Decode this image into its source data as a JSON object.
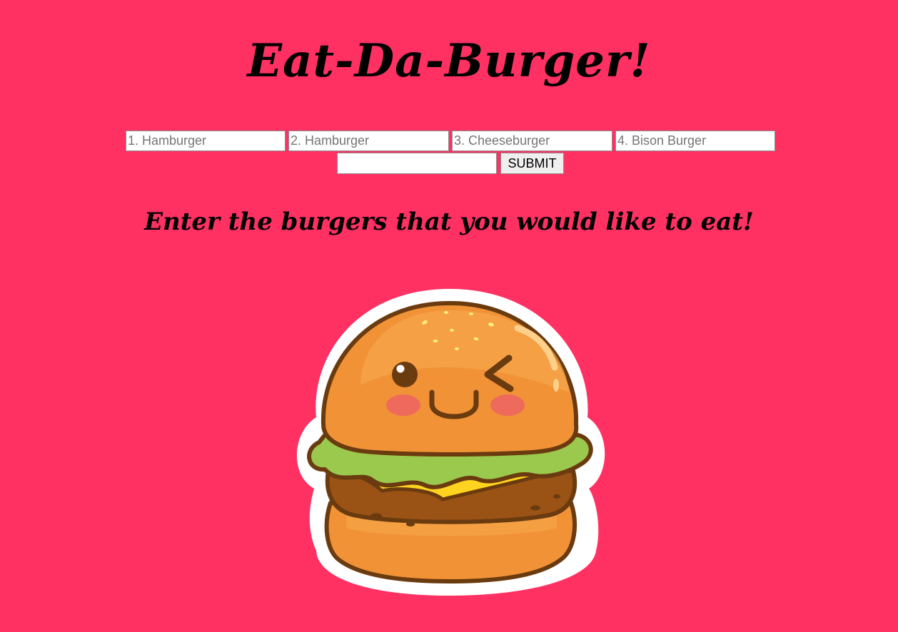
{
  "page": {
    "title": "Eat-Da-Burger!",
    "subtitle": "Enter the burgers that you would like to eat!",
    "background_color": "#ff3163"
  },
  "form": {
    "inputs": [
      {
        "placeholder": "1. Hamburger",
        "value": ""
      },
      {
        "placeholder": "2. Hamburger",
        "value": ""
      },
      {
        "placeholder": "3. Cheeseburger",
        "value": ""
      },
      {
        "placeholder": "4. Bison Burger",
        "value": ""
      },
      {
        "placeholder": "",
        "value": ""
      }
    ],
    "submit_label": "SUBMIT"
  },
  "illustration": {
    "icon": "winking-burger-illustration"
  }
}
